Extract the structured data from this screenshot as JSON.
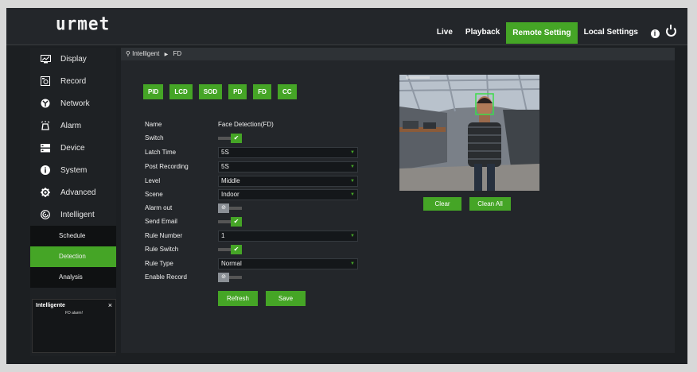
{
  "brand": {
    "logo": "urmet",
    "accent": "#45a526"
  },
  "nav": {
    "live": "Live",
    "playback": "Playback",
    "remote_setting": "Remote Setting",
    "local_settings": "Local Settings",
    "info_icon": "info-icon",
    "power_icon": "power-icon"
  },
  "sidebar": {
    "items": [
      {
        "label": "Display",
        "icon": "display-icon"
      },
      {
        "label": "Record",
        "icon": "record-icon"
      },
      {
        "label": "Network",
        "icon": "network-icon"
      },
      {
        "label": "Alarm",
        "icon": "alarm-icon"
      },
      {
        "label": "Device",
        "icon": "device-icon"
      },
      {
        "label": "System",
        "icon": "system-info-icon"
      },
      {
        "label": "Advanced",
        "icon": "gear-icon"
      },
      {
        "label": "Intelligent",
        "icon": "intelligent-icon"
      }
    ],
    "subitems": [
      {
        "label": "Schedule"
      },
      {
        "label": "Detection"
      },
      {
        "label": "Analysis"
      }
    ]
  },
  "popup": {
    "title": "Intelligente",
    "message": "FD alarm!",
    "close": "×"
  },
  "breadcrumb": {
    "root": "Intelligent",
    "current": "FD"
  },
  "tabs": [
    "PID",
    "LCD",
    "SOD",
    "PD",
    "FD",
    "CC"
  ],
  "form": {
    "name": {
      "label": "Name",
      "value": "Face Detection(FD)"
    },
    "switch": {
      "label": "Switch",
      "state": "on"
    },
    "latch_time": {
      "label": "Latch Time",
      "value": "5S"
    },
    "post_recording": {
      "label": "Post Recording",
      "value": "5S"
    },
    "level": {
      "label": "Level",
      "value": "Middle"
    },
    "scene": {
      "label": "Scene",
      "value": "Indoor"
    },
    "alarm_out": {
      "label": "Alarm out",
      "state": "off"
    },
    "send_email": {
      "label": "Send Email",
      "state": "on"
    },
    "rule_number": {
      "label": "Rule Number",
      "value": "1"
    },
    "rule_switch": {
      "label": "Rule Switch",
      "state": "on"
    },
    "rule_type": {
      "label": "Rule Type",
      "value": "Normal"
    },
    "enable_record": {
      "label": "Enable Record",
      "state": "off"
    }
  },
  "buttons": {
    "refresh": "Refresh",
    "save": "Save",
    "clear": "Clear",
    "clean_all": "Clean All"
  },
  "toggle_glyphs": {
    "on": "✔",
    "off": "⊘"
  },
  "caret": "▼",
  "bc_sep": "▶",
  "location_glyph": "⚲"
}
